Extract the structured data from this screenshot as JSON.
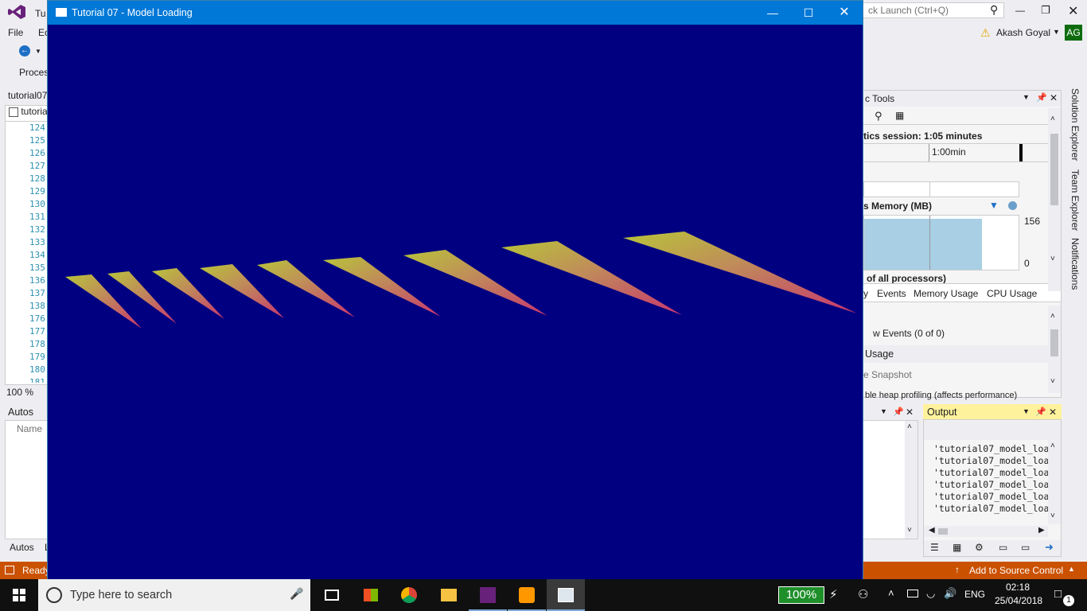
{
  "vs": {
    "title_fragment": "Tu",
    "menu": [
      "File",
      "Ec"
    ],
    "toolbar2_label": "Proces",
    "quick_launch": "ck Launch (Ctrl+Q)",
    "user_name": "Akash Goyal",
    "user_initials": "AG",
    "editor_tab": "tutorial07",
    "editor_file": "tutoria",
    "line_numbers": [
      "124",
      "125",
      "126",
      "127",
      "128",
      "129",
      "130",
      "131",
      "132",
      "133",
      "134",
      "135",
      "136",
      "137",
      "138",
      "176",
      "177",
      "178",
      "179",
      "180",
      "181"
    ],
    "zoom": "100 %",
    "autos_title": "Autos",
    "autos_column": "Name",
    "autos_tab": "Autos",
    "autos_tab2": "L",
    "status": "Ready",
    "source_control": "Add to Source Control",
    "accent": "#ca5100"
  },
  "diag": {
    "title": "c Tools",
    "session": "tics session: 1:05 minutes",
    "timeline_label": "1:00min",
    "memory_label": "s Memory (MB)",
    "mem_max": "156",
    "mem_min": "0",
    "cpu_label": "of all processors)",
    "tab_fragment": "y",
    "tabs": [
      "Events",
      "Memory Usage",
      "CPU Usage"
    ],
    "events_text": "w Events (0 of 0)",
    "usage_header": "Usage",
    "snapshot": "e Snapshot",
    "heap_text": "ble heap profiling (affects performance)"
  },
  "side_tabs": [
    "Solution Explorer",
    "Team Explorer",
    "Notifications"
  ],
  "output": {
    "title": "Output",
    "lines": [
      "'tutorial07_model_loa",
      "'tutorial07_model_loa",
      "'tutorial07_model_loa",
      "'tutorial07_model_loa",
      "'tutorial07_model_loa",
      "'tutorial07_model_loa"
    ]
  },
  "game": {
    "title": "Tutorial 07 - Model Loading",
    "background": "#000080"
  },
  "taskbar": {
    "search_placeholder": "Type here to search",
    "battery": "100%",
    "language": "ENG",
    "time": "02:18",
    "date": "25/04/2018",
    "notification_count": "1"
  }
}
